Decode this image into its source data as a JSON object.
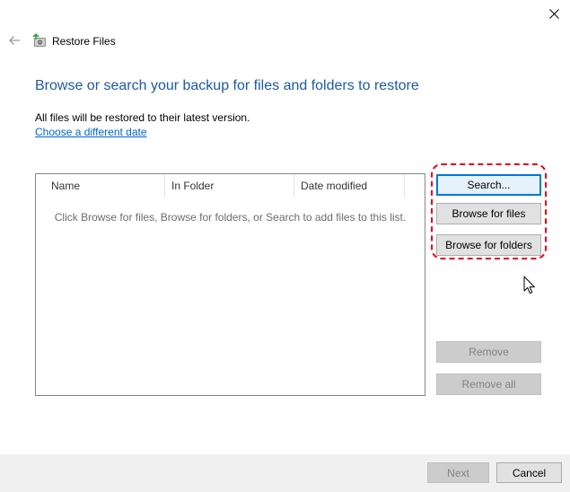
{
  "window": {
    "title": "Restore Files",
    "icons": {
      "close": "close-icon",
      "back": "back-arrow-icon",
      "app": "restore-files-icon"
    }
  },
  "main": {
    "heading": "Browse or search your backup for files and folders to restore",
    "info": "All files will be restored to their latest version.",
    "date_link": "Choose a different date",
    "file_list": {
      "columns": [
        "Name",
        "In Folder",
        "Date modified"
      ],
      "empty_message": "Click Browse for files, Browse for folders, or Search to add files to this list."
    }
  },
  "buttons": {
    "search": "Search...",
    "browse_files": "Browse for files",
    "browse_folders": "Browse for folders",
    "remove": "Remove",
    "remove_all": "Remove all"
  },
  "footer": {
    "next": "Next",
    "cancel": "Cancel"
  },
  "colors": {
    "heading": "#1e5aa0",
    "link": "#0066cc",
    "default_border": "#0078d7",
    "highlight": "#e0001b"
  }
}
